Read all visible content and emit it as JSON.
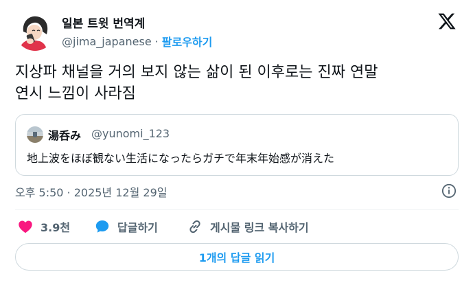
{
  "tweet": {
    "author_name": "일본 트윗 번역계",
    "author_handle": "@jima_japanese",
    "separator": "·",
    "follow_label": "팔로우하기",
    "text_line1": "지상파 채널을 거의 보지 않는 삶이 된 이후로는 진짜 연말",
    "text_line2": "연시 느낌이 사라짐",
    "timestamp": "오후 5:50 · 2025년 12월 29일"
  },
  "quote": {
    "author_name": "湯呑み",
    "author_handle": "@yunomi_123",
    "text": "地上波をほぼ観ない生活になったらガチで年末年始感が消えた"
  },
  "actions": {
    "like_count": "3.9천",
    "reply_label": "답글하기",
    "share_label": "게시물 링크 복사하기"
  },
  "read_replies_label": "1개의 답글 읽기",
  "colors": {
    "accent": "#1d9bf0",
    "like": "#f91880",
    "text": "#0f1419",
    "secondary": "#536471",
    "border": "#cfd9de"
  },
  "icons": [
    "x-logo-icon",
    "info-icon",
    "heart-icon",
    "reply-bubble-icon",
    "link-icon"
  ]
}
